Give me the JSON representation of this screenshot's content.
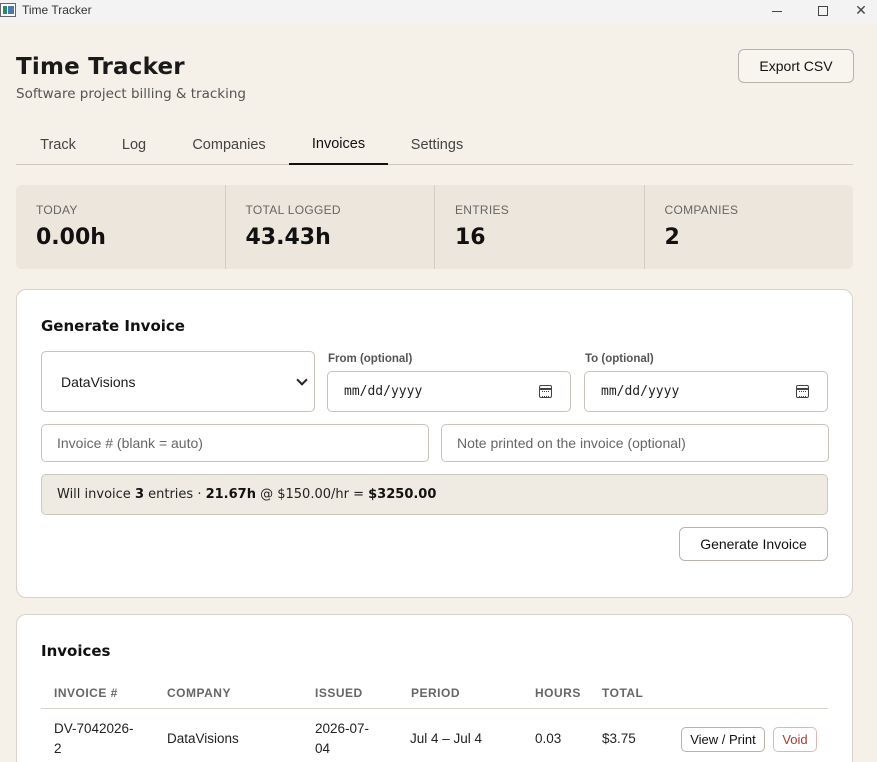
{
  "window": {
    "title": "Time Tracker"
  },
  "header": {
    "title": "Time Tracker",
    "subtitle": "Software project billing & tracking",
    "export_label": "Export CSV"
  },
  "tabs": [
    {
      "label": "Track"
    },
    {
      "label": "Log"
    },
    {
      "label": "Companies"
    },
    {
      "label": "Invoices",
      "active": true
    },
    {
      "label": "Settings"
    }
  ],
  "stats": [
    {
      "label": "TODAY",
      "value": "0.00h"
    },
    {
      "label": "TOTAL LOGGED",
      "value": "43.43h"
    },
    {
      "label": "ENTRIES",
      "value": "16"
    },
    {
      "label": "COMPANIES",
      "value": "2"
    }
  ],
  "generate": {
    "title": "Generate Invoice",
    "company_selected": "DataVisions",
    "from_label": "From (optional)",
    "from_placeholder": "mm/dd/yyyy",
    "to_label": "To (optional)",
    "to_placeholder": "mm/dd/yyyy",
    "invoice_no_placeholder": "Invoice # (blank = auto)",
    "note_placeholder": "Note printed on the invoice (optional)",
    "summary": {
      "prefix": "Will invoice",
      "entries": "3",
      "entries_suffix": "entries ·",
      "hours": "21.67h",
      "rate_text": "@ $150.00/hr =",
      "total": "$3250.00"
    },
    "button_label": "Generate Invoice"
  },
  "invoices": {
    "title": "Invoices",
    "columns": [
      "INVOICE #",
      "COMPANY",
      "ISSUED",
      "PERIOD",
      "HOURS",
      "TOTAL"
    ],
    "rows": [
      {
        "invoice_line1": "DV-7042026-",
        "invoice_line2": "2",
        "company": "DataVisions",
        "issued_line1": "2026-07-",
        "issued_line2": "04",
        "period": "Jul 4 – Jul 4",
        "hours": "0.03",
        "total": "$3.75",
        "view_label": "View / Print",
        "void_label": "Void"
      }
    ]
  },
  "colors": {
    "background": "#f5f0e8",
    "card": "#ffffff",
    "stats_bg": "#ece6dd",
    "void_red": "#b03a2e"
  }
}
